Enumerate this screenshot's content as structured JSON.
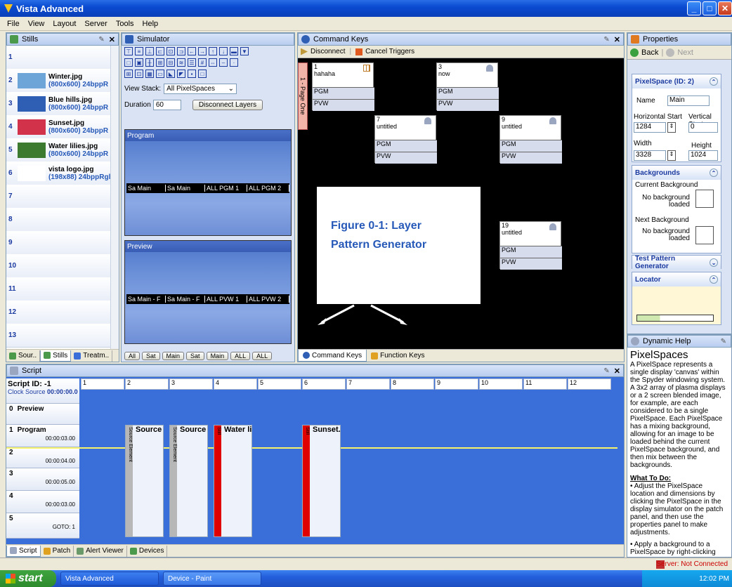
{
  "app": {
    "title": "Vista Advanced"
  },
  "menu": [
    "File",
    "View",
    "Layout",
    "Server",
    "Tools",
    "Help"
  ],
  "stills": {
    "title": "Stills",
    "items": [
      {
        "num": "1",
        "name": "",
        "info": "",
        "thumb": ""
      },
      {
        "num": "2",
        "name": "Winter.jpg",
        "info": "(800x600) 24bppR",
        "thumb": "#6ea5d8"
      },
      {
        "num": "3",
        "name": "Blue hills.jpg",
        "info": "(800x600) 24bppR",
        "thumb": "#2e5fb5"
      },
      {
        "num": "4",
        "name": "Sunset.jpg",
        "info": "(800x600) 24bppR",
        "thumb": "#d2334a"
      },
      {
        "num": "5",
        "name": "Water lilies.jpg",
        "info": "(800x600) 24bppR",
        "thumb": "#3b7a2f"
      },
      {
        "num": "6",
        "name": "vista logo.jpg",
        "info": "(198x88) 24bppRgl",
        "thumb": "#fff"
      },
      {
        "num": "7"
      },
      {
        "num": "8"
      },
      {
        "num": "9"
      },
      {
        "num": "10"
      },
      {
        "num": "11"
      },
      {
        "num": "12"
      },
      {
        "num": "13"
      }
    ],
    "tabs": [
      "Sour..",
      "Stills",
      "Treatm.."
    ]
  },
  "simulator": {
    "title": "Simulator",
    "view_stack_label": "View Stack:",
    "view_stack_value": "All PixelSpaces",
    "duration_label": "Duration",
    "duration_value": "60",
    "disconnect_label": "Disconnect Layers",
    "program_label": "Program",
    "preview_label": "Preview",
    "program_layers": [
      "Sa Main",
      "Sa Main",
      "ALL PGM 1",
      "ALL PGM 2"
    ],
    "preview_layers": [
      "Sa Main - F",
      "Sa Main - F",
      "ALL PVW 1",
      "ALL PVW 2"
    ],
    "tabs": [
      "All",
      "Sat",
      "Main",
      "Sat",
      "Main",
      "ALL",
      "ALL"
    ]
  },
  "command_keys": {
    "title": "Command Keys",
    "disconnect": "Disconnect",
    "cancel": "Cancel Triggers",
    "page_tab": "1 - Page One",
    "keys": [
      {
        "num": "1",
        "title": "hahaha",
        "pgm": "PGM",
        "pvw": "PVW"
      },
      {
        "num": "3",
        "title": "now",
        "pgm": "PGM",
        "pvw": "PVW"
      },
      {
        "num": "7",
        "title": "untitled",
        "pgm": "PGM",
        "pvw": "PVW"
      },
      {
        "num": "9",
        "title": "untitled",
        "pgm": "PGM",
        "pvw": "PVW"
      },
      {
        "num": "19",
        "title": "untitled",
        "pgm": "PGM",
        "pvw": "PVW"
      }
    ],
    "figure_caption_1": "Figure 0-1: Layer",
    "figure_caption_2": "Pattern Generator",
    "tabs": [
      "Command Keys",
      "Function Keys"
    ]
  },
  "properties": {
    "title": "Properties",
    "back": "Back",
    "next": "Next",
    "pixelspace_title": "PixelSpace (ID: 2)",
    "name_label": "Name",
    "name_value": "Main",
    "hstart_label": "Horizontal Start",
    "hstart_value": "1284",
    "vstart_label": "Vertical Start",
    "vstart_value": "0",
    "width_label": "Width",
    "width_value": "3328",
    "height_label": "Height",
    "height_value": "1024",
    "backgrounds_title": "Backgrounds",
    "current_bg": "Current Background",
    "next_bg": "Next Background",
    "no_bg_1": "No background",
    "no_bg_2": "loaded",
    "test_pattern": "Test Pattern Generator",
    "locator": "Locator"
  },
  "help": {
    "title": "Dynamic Help",
    "heading": "PixelSpaces",
    "body": "A PixelSpace represents a single display 'canvas' within the Spyder windowing system. A 3x2 array of plasma displays or a 2 screen blended image, for example, are each considered to be a single PixelSpace. Each PixelSpace has a mixing background, allowing for an image to be loaded behind the current PixelSpace background, and then mix between the backgrounds.",
    "todo": "What To Do:",
    "bullet1": "Adjust the PixelSpace location and dimensions by clicking the PixelSpace in the display simulator on the patch panel, and then use the properties panel to make adjustments.",
    "bullet2": "Apply a background to a PixelSpace by right-clicking"
  },
  "script": {
    "title": "Script",
    "id": "Script ID: -1",
    "clock": "Clock Source",
    "clock_value": "00:00:00.0",
    "columns": [
      "1",
      "2",
      "3",
      "4",
      "5",
      "6",
      "7",
      "8",
      "9",
      "10",
      "11",
      "12"
    ],
    "tracks": [
      {
        "num": "0",
        "name": "Preview",
        "time": ""
      },
      {
        "num": "1",
        "name": "Program",
        "time": "00:00:03.00"
      },
      {
        "num": "2",
        "name": "",
        "time": "00:00:04.00"
      },
      {
        "num": "3",
        "name": "",
        "time": "00:00:05.00"
      },
      {
        "num": "4",
        "name": "",
        "time": "00:00:03.00"
      },
      {
        "num": "5",
        "name": "",
        "time": "GOTO: 1"
      }
    ],
    "elements": [
      {
        "label": "Source",
        "bar": "#b7b7b7",
        "side": "Source Element"
      },
      {
        "label": "Source",
        "bar": "#b7b7b7",
        "side": "Source Element"
      },
      {
        "label": "Water lil",
        "bar": "#e00000",
        "side": "Still"
      },
      {
        "label": "Sunset.j",
        "bar": "#e00000",
        "side": "Still"
      }
    ],
    "tabs": [
      "Script",
      "Patch",
      "Alert Viewer",
      "Devices"
    ]
  },
  "status": {
    "server": "Server: Not Connected"
  },
  "taskbar": {
    "start": "start",
    "task1": "Vista Advanced",
    "task2": "Device - Paint",
    "time": "12:02 PM"
  }
}
